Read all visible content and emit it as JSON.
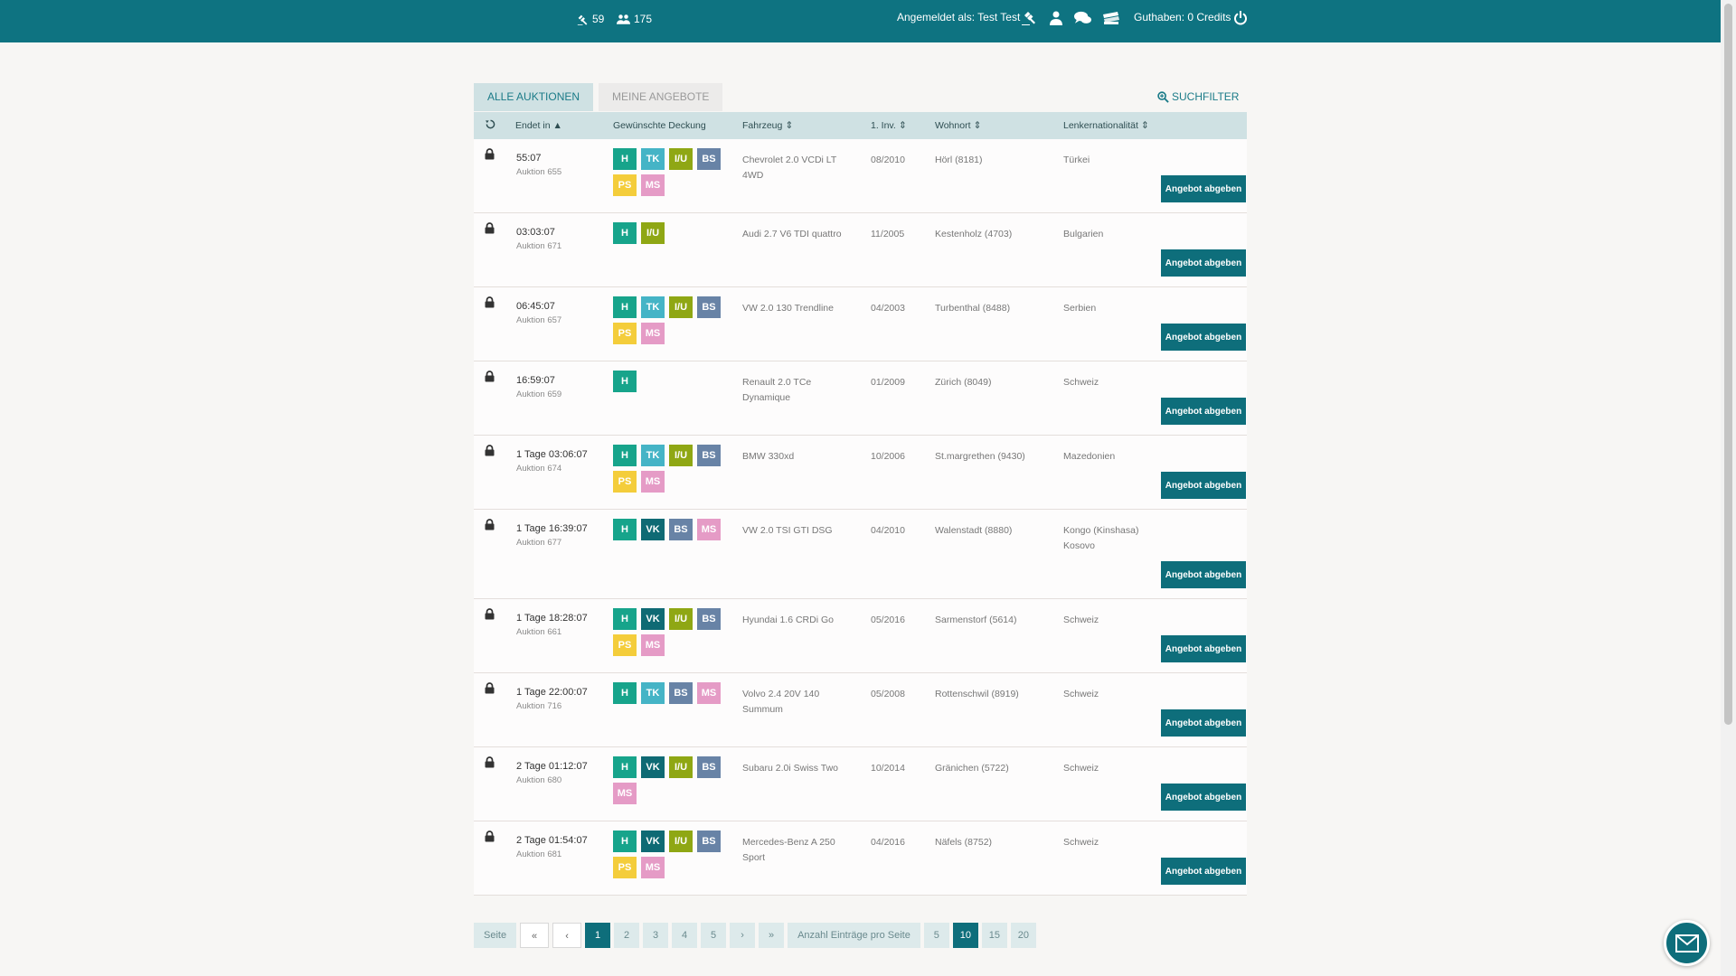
{
  "header": {
    "stat_auctions": "59",
    "stat_users": "175",
    "login_text": "Angemeldet als: Test Test",
    "credits_text": "Guthaben: 0 Credits"
  },
  "tabs": [
    {
      "label": "ALLE AUKTIONEN",
      "active": true
    },
    {
      "label": "MEINE ANGEBOTE",
      "active": false
    }
  ],
  "search_filter_label": "SUCHFILTER",
  "columns": {
    "ends": "Endet in",
    "coverage": "Gewünschte Deckung",
    "vehicle": "Fahrzeug",
    "first_reg": "1. Inv.",
    "residence": "Wohnort",
    "nationality": "Lenkernationalität"
  },
  "offer_button_label": "Angebot abgeben",
  "colors": {
    "primary": "#0e7381",
    "H": "#17a48b",
    "TK": "#45b4c6",
    "I/U": "#8fa714",
    "BS": "#6883a6",
    "PS": "#f4cd3b",
    "MS": "#e59bc6",
    "VK": "#0f6a74"
  },
  "rows": [
    {
      "time": "55:07",
      "auction": "Auktion 655",
      "badges": [
        "H",
        "TK",
        "I/U",
        "BS",
        "PS",
        "MS"
      ],
      "vehicle": "Chevrolet 2.0 VCDi LT 4WD",
      "first_reg": "08/2010",
      "residence": "Hörl (8181)",
      "nationality": "Türkei"
    },
    {
      "time": "03:03:07",
      "auction": "Auktion 671",
      "badges": [
        "H",
        "I/U"
      ],
      "vehicle": "Audi 2.7 V6 TDI quattro",
      "first_reg": "11/2005",
      "residence": "Kestenholz (4703)",
      "nationality": "Bulgarien"
    },
    {
      "time": "06:45:07",
      "auction": "Auktion 657",
      "badges": [
        "H",
        "TK",
        "I/U",
        "BS",
        "PS",
        "MS"
      ],
      "vehicle": "VW 2.0 130 Trendline",
      "first_reg": "04/2003",
      "residence": "Turbenthal (8488)",
      "nationality": "Serbien"
    },
    {
      "time": "16:59:07",
      "auction": "Auktion 659",
      "badges": [
        "H"
      ],
      "vehicle": "Renault 2.0 TCe Dynamique",
      "first_reg": "01/2009",
      "residence": "Zürich (8049)",
      "nationality": "Schweiz"
    },
    {
      "time": "1 Tage 03:06:07",
      "auction": "Auktion 674",
      "badges": [
        "H",
        "TK",
        "I/U",
        "BS",
        "PS",
        "MS"
      ],
      "vehicle": "BMW 330xd",
      "first_reg": "10/2006",
      "residence": "St.margrethen (9430)",
      "nationality": "Mazedonien"
    },
    {
      "time": "1 Tage 16:39:07",
      "auction": "Auktion 677",
      "badges": [
        "H",
        "VK",
        "BS",
        "MS"
      ],
      "vehicle": "VW 2.0 TSI GTI DSG",
      "first_reg": "04/2010",
      "residence": "Walenstadt (8880)",
      "nationality": "Kongo (Kinshasa) Kosovo",
      "tall": true
    },
    {
      "time": "1 Tage 18:28:07",
      "auction": "Auktion 661",
      "badges": [
        "H",
        "VK",
        "I/U",
        "BS",
        "PS",
        "MS"
      ],
      "vehicle": "Hyundai 1.6 CRDi Go",
      "first_reg": "05/2016",
      "residence": "Sarmenstorf (5614)",
      "nationality": "Schweiz"
    },
    {
      "time": "1 Tage 22:00:07",
      "auction": "Auktion 716",
      "badges": [
        "H",
        "TK",
        "BS",
        "MS"
      ],
      "vehicle": "Volvo 2.4 20V 140 Summum",
      "first_reg": "05/2008",
      "residence": "Rottenschwil (8919)",
      "nationality": "Schweiz"
    },
    {
      "time": "2 Tage 01:12:07",
      "auction": "Auktion 680",
      "badges": [
        "H",
        "VK",
        "I/U",
        "BS",
        "MS"
      ],
      "vehicle": "Subaru 2.0i Swiss Two",
      "first_reg": "10/2014",
      "residence": "Gränichen (5722)",
      "nationality": "Schweiz"
    },
    {
      "time": "2 Tage 01:54:07",
      "auction": "Auktion 681",
      "badges": [
        "H",
        "VK",
        "I/U",
        "BS",
        "PS",
        "MS"
      ],
      "vehicle": "Mercedes-Benz A 250 Sport",
      "first_reg": "04/2016",
      "residence": "Näfels (8752)",
      "nationality": "Schweiz"
    }
  ],
  "pagination": {
    "page_label": "Seite",
    "pages": [
      "1",
      "2",
      "3",
      "4",
      "5"
    ],
    "current_page": "1",
    "per_page_label": "Anzahl Einträge pro Seite",
    "per_page_options": [
      "5",
      "10",
      "15",
      "20"
    ],
    "current_per_page": "10"
  }
}
